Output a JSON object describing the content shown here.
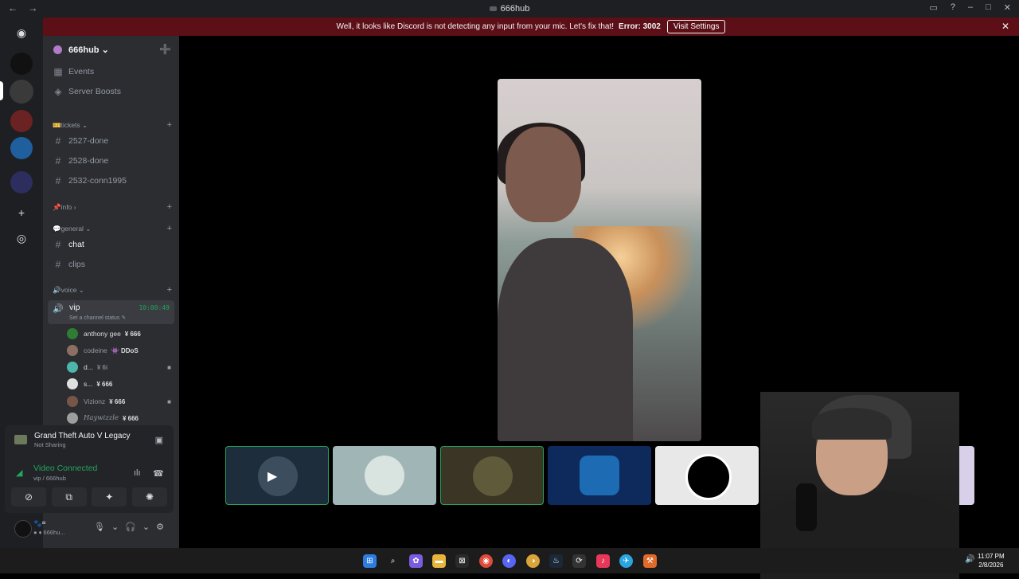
{
  "window": {
    "title": "666hub",
    "back": "←",
    "forward": "→",
    "inbox_icon": "▭",
    "help_icon": "?",
    "min": "–",
    "max": "□",
    "close": "✕"
  },
  "banner": {
    "message": "Well, it looks like Discord is not detecting any input from your mic. Let's fix that!",
    "error": "Error: 3002",
    "button": "Visit Settings",
    "close": "✕"
  },
  "server_rail": {
    "home_icon": "◉",
    "add_icon": "+",
    "discover_icon": "◎"
  },
  "server": {
    "name": "666hub",
    "chevron": "⌄",
    "add_member_icon": "➕",
    "menu": [
      {
        "icon": "▦",
        "label": "Events"
      },
      {
        "icon": "◈",
        "label": "Server Boosts"
      }
    ],
    "categories": [
      {
        "label": "🎫tickets ⌄",
        "channels": [
          "2527-done",
          "2528-done",
          "2532-conn1995"
        ]
      },
      {
        "label": "📌info ›",
        "channels": []
      },
      {
        "label": "💬general ⌄",
        "channels": [
          "chat",
          "clips"
        ]
      },
      {
        "label": "🔊voice ⌄",
        "channels": []
      }
    ],
    "voice_channel": {
      "name": "vip",
      "timer": "10:00:49",
      "status": "Set a channel status ✎"
    },
    "voice_users": [
      {
        "name": "anthony gee",
        "tag": "¥ 666",
        "color": "#2e7d32"
      },
      {
        "name": "codeine",
        "tag": "👾 DDoS",
        "color": "#8d6e63"
      },
      {
        "name": "d...",
        "tag": "¥ 6i",
        "color": "#4db6ac"
      },
      {
        "name": "s...",
        "tag": "¥ 666",
        "color": "#e0e0e0"
      },
      {
        "name": "Vizionz",
        "tag": "¥ 666",
        "color": "#795548"
      },
      {
        "name": "Haywizzle",
        "tag": "¥ 666",
        "color": "#9e9e9e"
      }
    ]
  },
  "activity": {
    "game": "Grand Theft Auto V Legacy",
    "game_status": "Not Sharing"
  },
  "voice_connection": {
    "status": "Video Connected",
    "location": "vip / 666hub"
  },
  "action_buttons": [
    "⊘",
    "⧉",
    "✦",
    "✺"
  ],
  "user_panel": {
    "name": "🐾ᵃᶦ",
    "status": "● ♦ 666hu..."
  },
  "user_controls": {
    "mic": "🎙",
    "mic_opts": "⌄",
    "headset": "🎧",
    "headset_opts": "⌄",
    "settings": "⚙"
  },
  "tiles": [
    {
      "icon": "▶",
      "bg": "#1d2d3b"
    },
    {
      "bg": "#9fb5b6"
    },
    {
      "bg": "#3a3524"
    },
    {
      "bg": "#0e2a5c"
    },
    {
      "bg": "#e8e8e8"
    },
    {
      "bg": "#d8d0e8"
    }
  ],
  "taskbar": {
    "icons": [
      "⊞",
      "⌕",
      "✿",
      "▬",
      "⊠",
      "◉",
      "◐",
      "◑",
      "♨",
      "⟳",
      "♪",
      "✈",
      "⚒"
    ],
    "time": "11:07 PM",
    "date": "2/8/2026",
    "volume": "🔊"
  }
}
